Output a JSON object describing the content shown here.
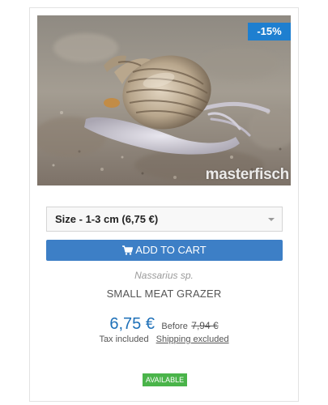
{
  "product": {
    "discount_badge": "-15%",
    "watermark": "masterfisch",
    "size_select": {
      "selected": "Size - 1-3 cm (6,75 €)"
    },
    "add_to_cart_label": "ADD TO CART",
    "scientific_name": "Nassarius sp.",
    "name": "SMALL MEAT GRAZER",
    "price": "6,75 €",
    "before_label": "Before",
    "old_price": "7,94 €",
    "tax_label": "Tax included",
    "shipping_label": "Shipping excluded",
    "availability": "AVAILABLE"
  },
  "colors": {
    "accent_blue": "#3d7fc6",
    "discount_badge": "#1e7fd0",
    "price": "#1e70b8",
    "available_green": "#4ab44a"
  },
  "icons": {
    "cart": "shopping-cart-icon",
    "dropdown": "caret-down-icon"
  }
}
